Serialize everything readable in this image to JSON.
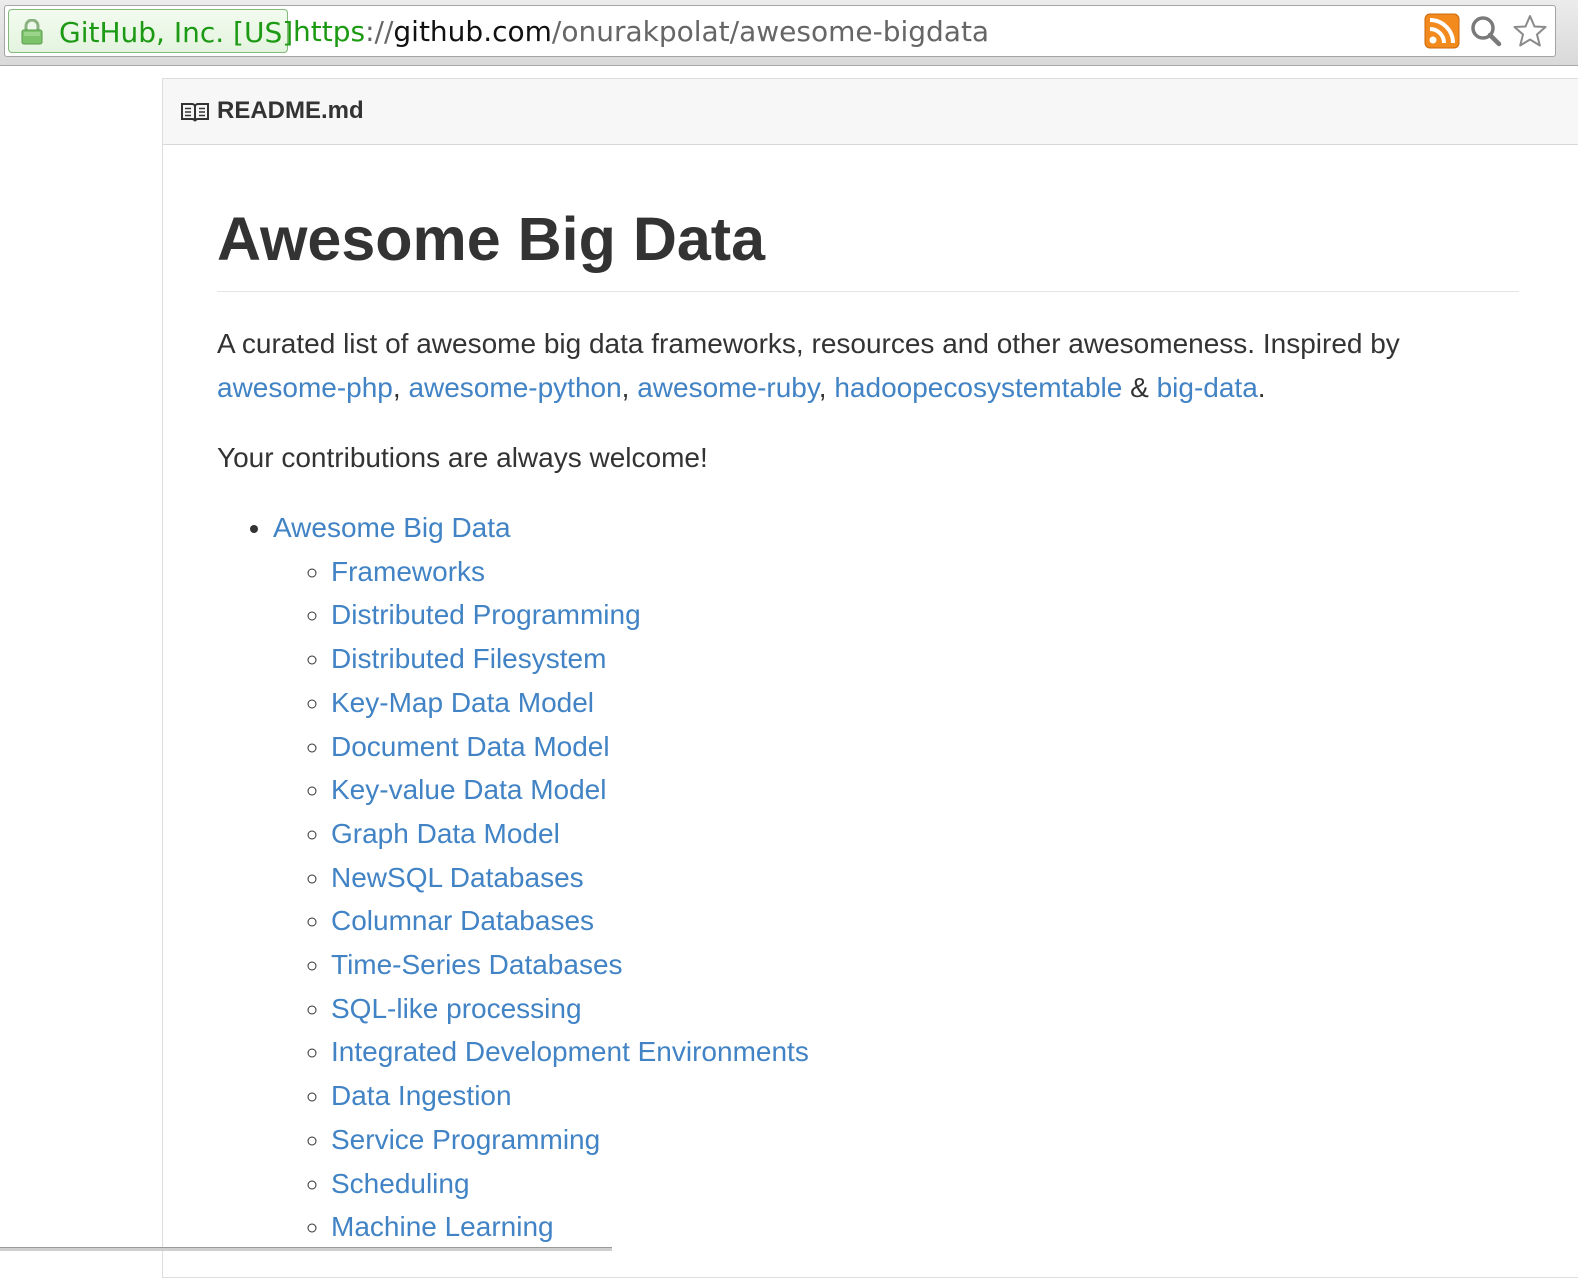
{
  "browser": {
    "ev_label": "GitHub, Inc. [US]",
    "url_scheme": "https",
    "url_sep": "://",
    "url_host": "github.com",
    "url_path": "/onurakpolat/awesome-bigdata",
    "icons": [
      "lock-icon",
      "rss-icon",
      "search-icon",
      "star-icon"
    ]
  },
  "file": {
    "icon": "book-icon",
    "name": "README.md"
  },
  "readme": {
    "title": "Awesome Big Data",
    "intro_text": "A curated list of awesome big data frameworks, resources and other awesomeness. Inspired by",
    "inspired_links": [
      "awesome-php",
      "awesome-python",
      "awesome-ruby",
      "hadoopecosystemtable",
      "big-data"
    ],
    "comma": ",",
    "ampersand": "&",
    "period": ".",
    "welcome": "Your contributions are always welcome!",
    "toc_root": "Awesome Big Data",
    "toc_items": [
      "Frameworks",
      "Distributed Programming",
      "Distributed Filesystem",
      "Key-Map Data Model",
      "Document Data Model",
      "Key-value Data Model",
      "Graph Data Model",
      "NewSQL Databases",
      "Columnar Databases",
      "Time-Series Databases",
      "SQL-like processing",
      "Integrated Development Environments",
      "Data Ingestion",
      "Service Programming",
      "Scheduling",
      "Machine Learning"
    ]
  },
  "colors": {
    "link": "#4183c4",
    "text": "#333333",
    "ev_green": "#1d9a14",
    "rss_orange": "#f28a1e"
  }
}
